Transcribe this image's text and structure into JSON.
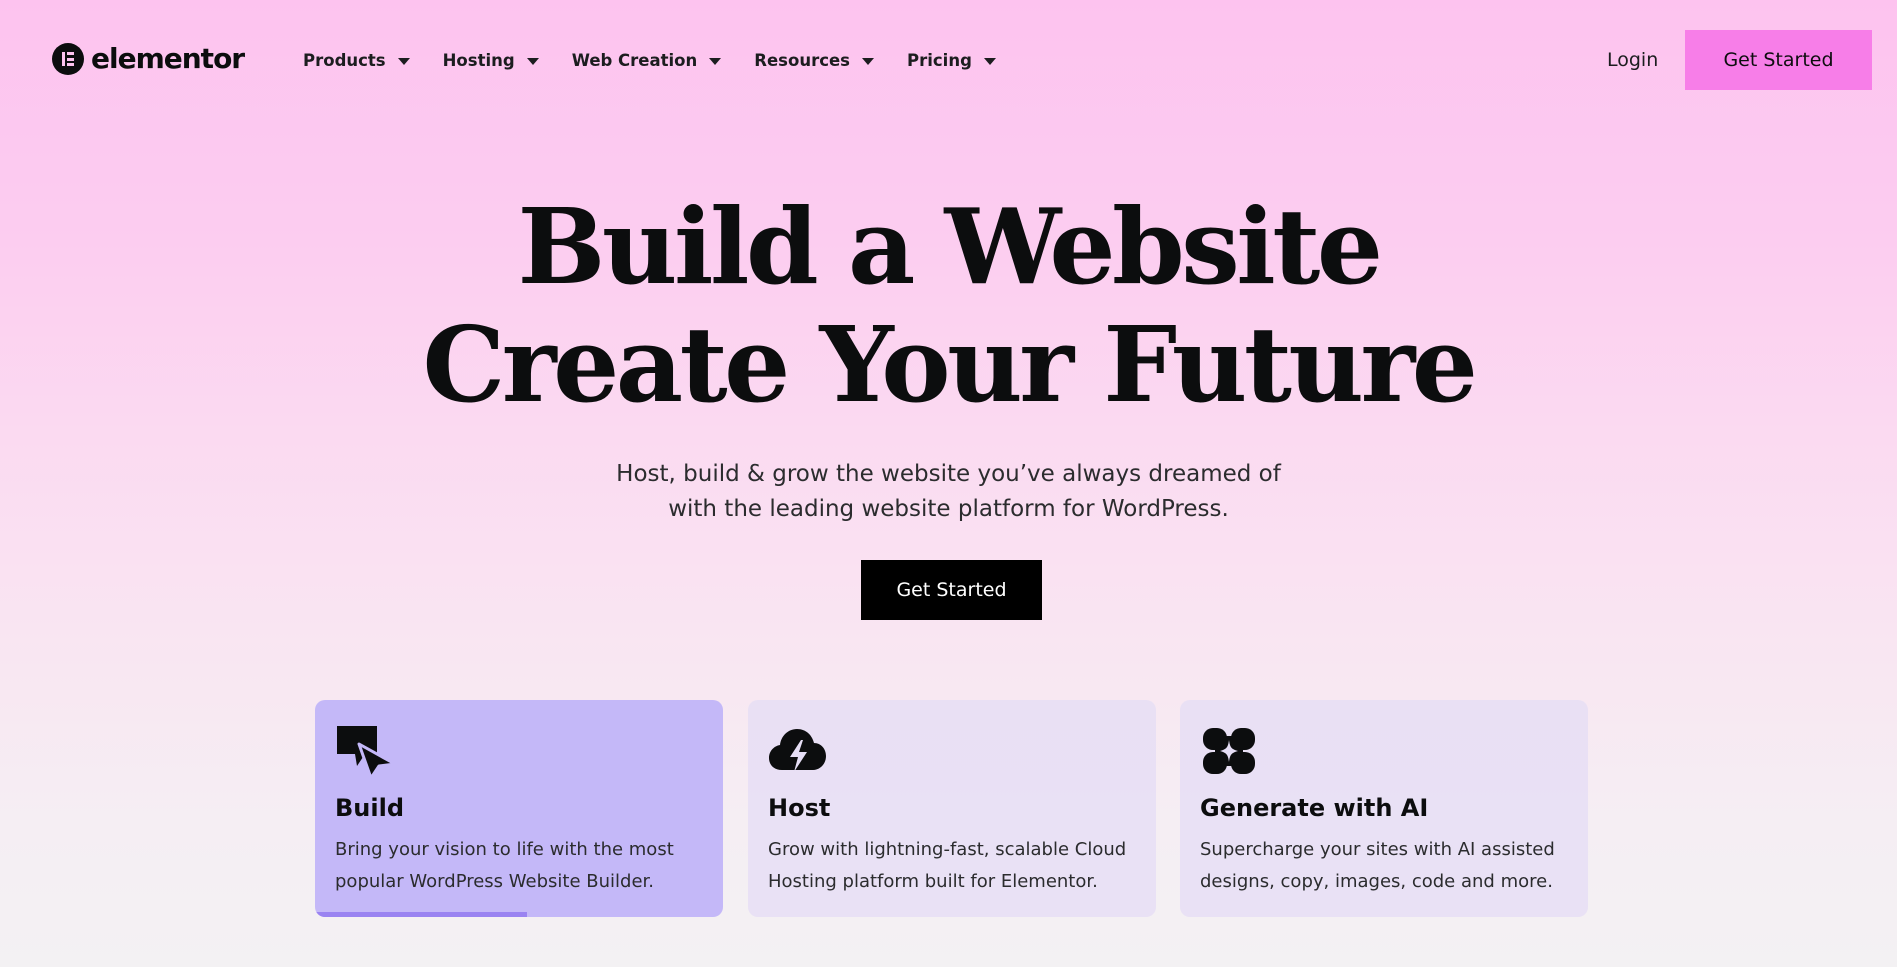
{
  "header": {
    "logo_text": "elementor",
    "nav": [
      {
        "label": "Products"
      },
      {
        "label": "Hosting"
      },
      {
        "label": "Web Creation"
      },
      {
        "label": "Resources"
      },
      {
        "label": "Pricing"
      }
    ],
    "login_label": "Login",
    "cta_label": "Get Started"
  },
  "hero": {
    "title_line1": "Build a Website",
    "title_line2": "Create Your Future",
    "subtitle_line1": "Host, build & grow the website you’ve always dreamed of",
    "subtitle_line2": "with the leading website platform for WordPress.",
    "cta_label": "Get Started"
  },
  "cards": [
    {
      "icon": "build-icon",
      "title": "Build",
      "text_line1": "Bring your vision to life with the most",
      "text_line2": "popular WordPress Website Builder.",
      "active": true,
      "progress": 0.52
    },
    {
      "icon": "cloud-lightning-icon",
      "title": "Host",
      "text_line1": "Grow with lightning-fast, scalable Cloud",
      "text_line2": "Hosting platform built for Elementor.",
      "active": false
    },
    {
      "icon": "ai-sparkle-icon",
      "title": "Generate with AI",
      "text_line1": "Supercharge your sites with AI assisted",
      "text_line2": "designs, copy, images, code and more.",
      "active": false
    }
  ],
  "colors": {
    "accent_pink": "#f77ee8",
    "active_card": "#c4b8f8",
    "progress": "#9a83f1"
  }
}
